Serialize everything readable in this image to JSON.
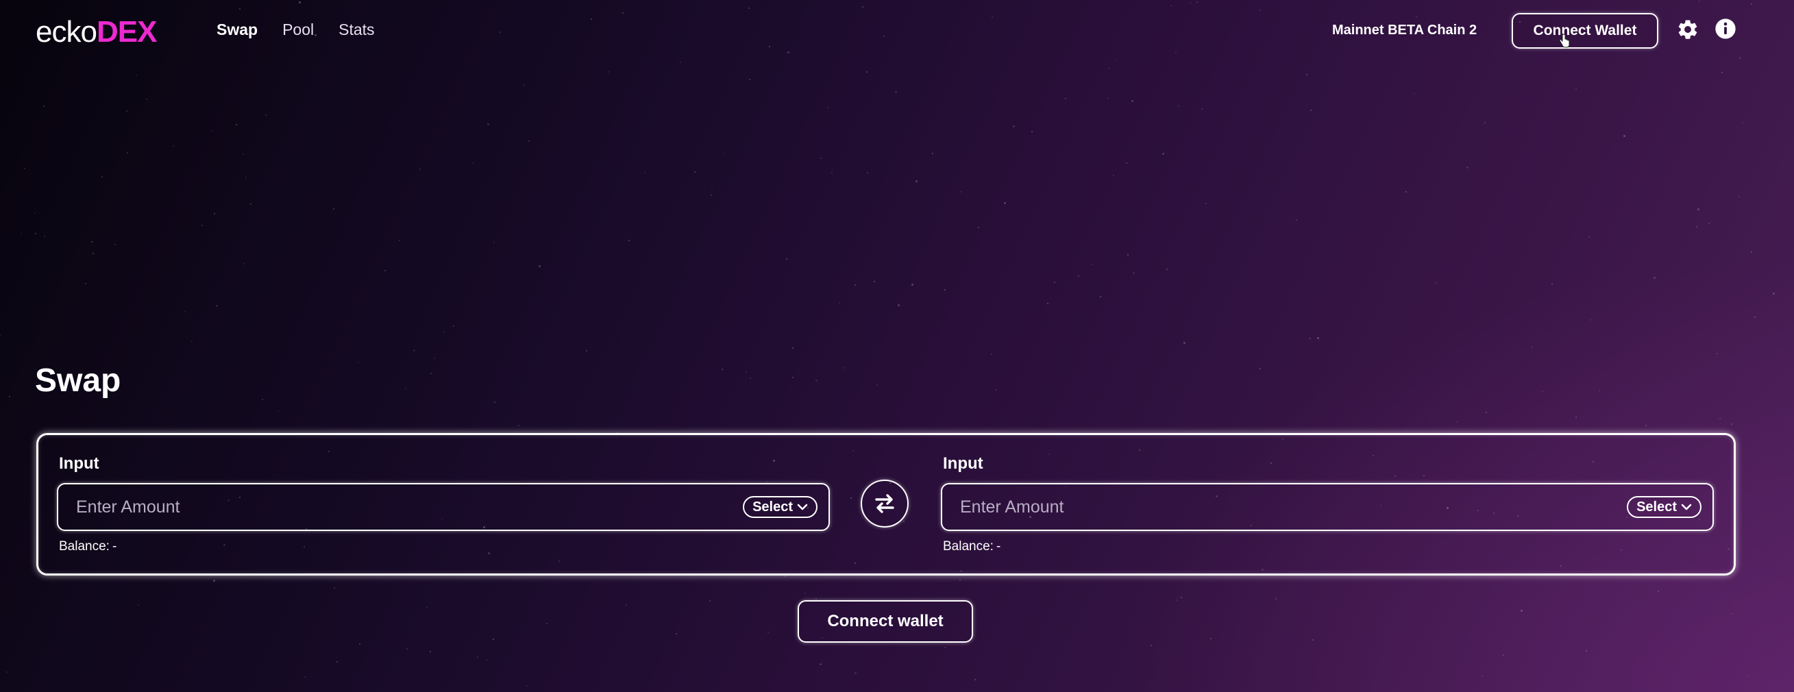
{
  "brand": {
    "name_prefix": "ecko",
    "name_suffix": "DEX"
  },
  "nav": {
    "items": [
      {
        "label": "Swap"
      },
      {
        "label": "Pool"
      },
      {
        "label": "Stats"
      }
    ],
    "active": "Swap"
  },
  "header": {
    "network": "Mainnet BETA Chain 2",
    "connect_wallet_label": "Connect Wallet",
    "icons": [
      "gear-icon",
      "info-icon"
    ]
  },
  "swap": {
    "title": "Swap",
    "from": {
      "label": "Input",
      "placeholder": "Enter Amount",
      "select_label": "Select",
      "balance_label": "Balance:",
      "balance_value": "-"
    },
    "to": {
      "label": "Input",
      "placeholder": "Enter Amount",
      "select_label": "Select",
      "balance_label": "Balance:",
      "balance_value": "-"
    },
    "swap_direction_icon": "swap-arrows-icon",
    "connect_button_label": "Connect wallet"
  },
  "colors": {
    "brand_accent": "#ec2ad0",
    "background_dark": "#07040d",
    "background_purple": "#4a1f56"
  }
}
